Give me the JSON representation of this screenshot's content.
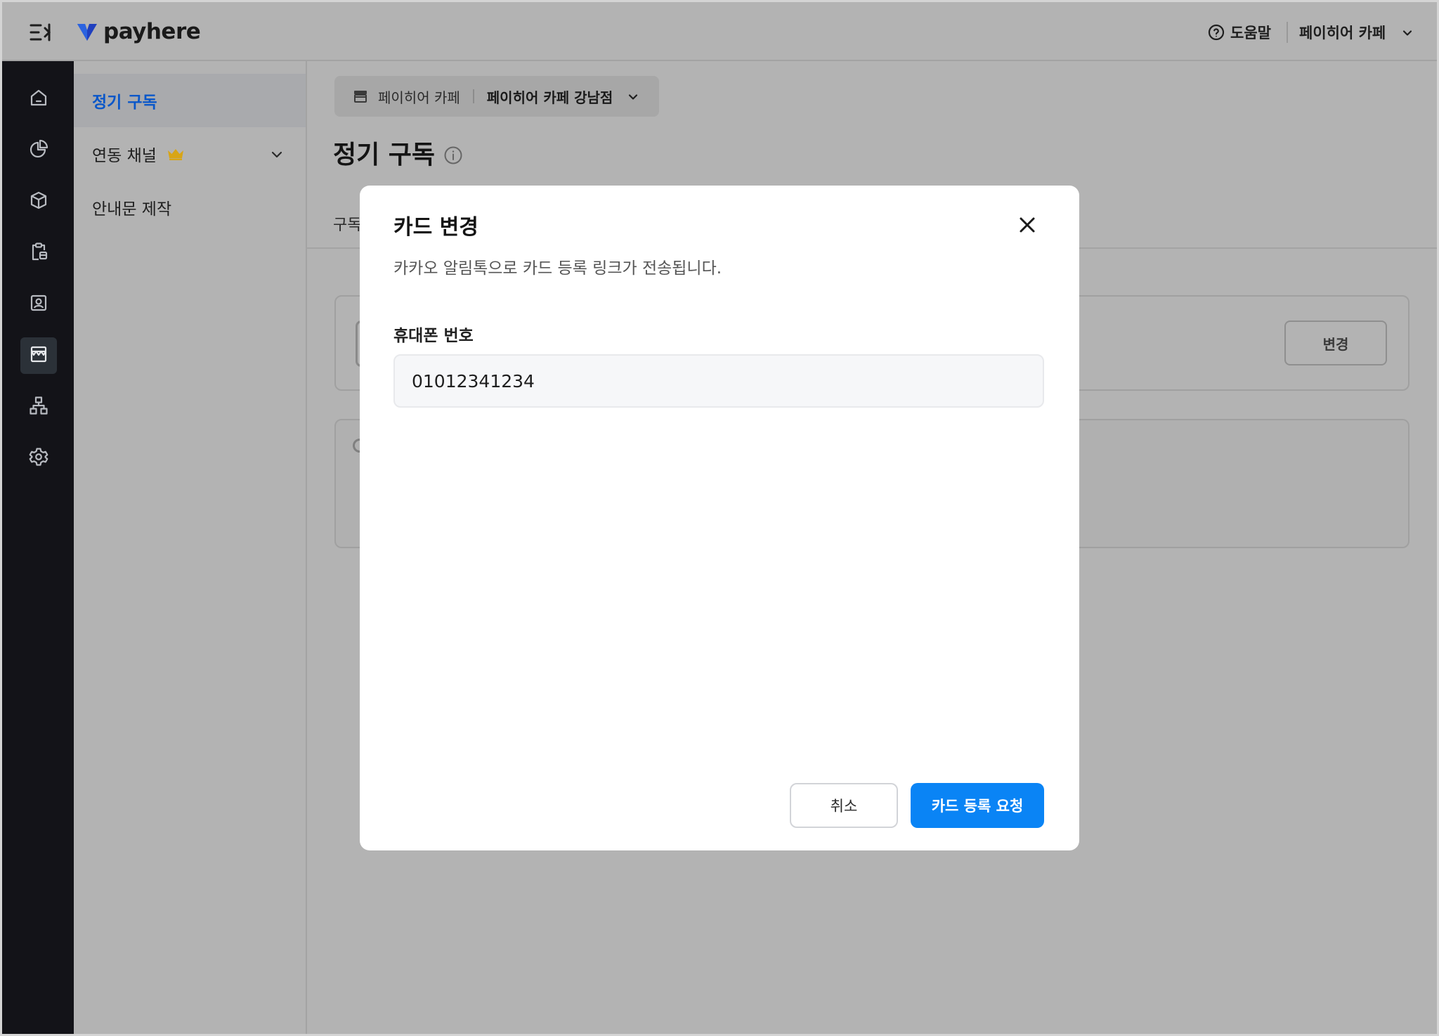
{
  "header": {
    "logo_text": "payhere",
    "help_label": "도움말",
    "store_name": "페이히어 카페"
  },
  "sidebar_icons": [
    {
      "icon": "home-icon"
    },
    {
      "icon": "pie-chart-icon"
    },
    {
      "icon": "box-icon"
    },
    {
      "icon": "clipboard-icon"
    },
    {
      "icon": "contact-card-icon"
    },
    {
      "icon": "store-icon",
      "active": true
    },
    {
      "icon": "org-chart-icon"
    },
    {
      "icon": "gear-icon"
    }
  ],
  "subnav": {
    "items": [
      {
        "label": "정기 구독",
        "active": true
      },
      {
        "label": "연동 채널",
        "badge": "crown-icon",
        "expandable": true
      },
      {
        "label": "안내문 제작"
      }
    ]
  },
  "main": {
    "store_selector": {
      "store": "페이히어 카페",
      "branch": "페이히어 카페 강남점"
    },
    "page_title": "정기 구독",
    "tab_partial": "구독",
    "change_button": "변경"
  },
  "modal": {
    "title": "카드 변경",
    "description": "카카오 알림톡으로 카드 등록 링크가 전송됩니다.",
    "phone_label": "휴대폰 번호",
    "phone_value": "01012341234",
    "cancel_label": "취소",
    "submit_label": "카드 등록 요청"
  },
  "colors": {
    "primary": "#0a84f5",
    "rail_bg": "#131318",
    "active_nav_text": "#0a57c9",
    "overlay": "#b3b3b3"
  }
}
